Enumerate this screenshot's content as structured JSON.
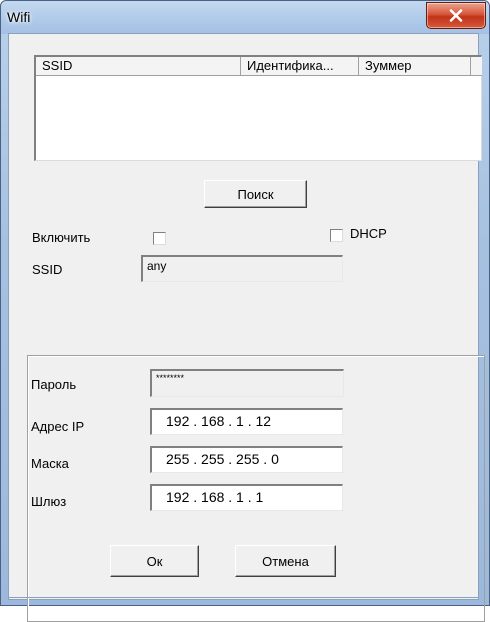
{
  "window": {
    "title": "Wifi",
    "close_icon": "close-x-icon",
    "close_button_color": "#c2331a"
  },
  "network_list": {
    "columns": [
      "SSID",
      "Идентифика...",
      "Зуммер"
    ],
    "rows": []
  },
  "search_button": {
    "label": "Поиск"
  },
  "enable": {
    "label": "Включить",
    "checked": false
  },
  "dhcp": {
    "label": "DHCP",
    "checked": false
  },
  "ssid": {
    "label": "SSID",
    "value": "any"
  },
  "password": {
    "label": "Пароль",
    "value": "********"
  },
  "ip_address": {
    "label": "Адрес IP",
    "value": "192  .  168  .    1   .   12"
  },
  "mask": {
    "label": "Маска",
    "value": "255  .  255  .  255  .    0"
  },
  "gateway": {
    "label": "Шлюз",
    "value": "192  .  168  .    1   .    1"
  },
  "ok_button": {
    "label": "Ок"
  },
  "cancel_button": {
    "label": "Отмена"
  }
}
